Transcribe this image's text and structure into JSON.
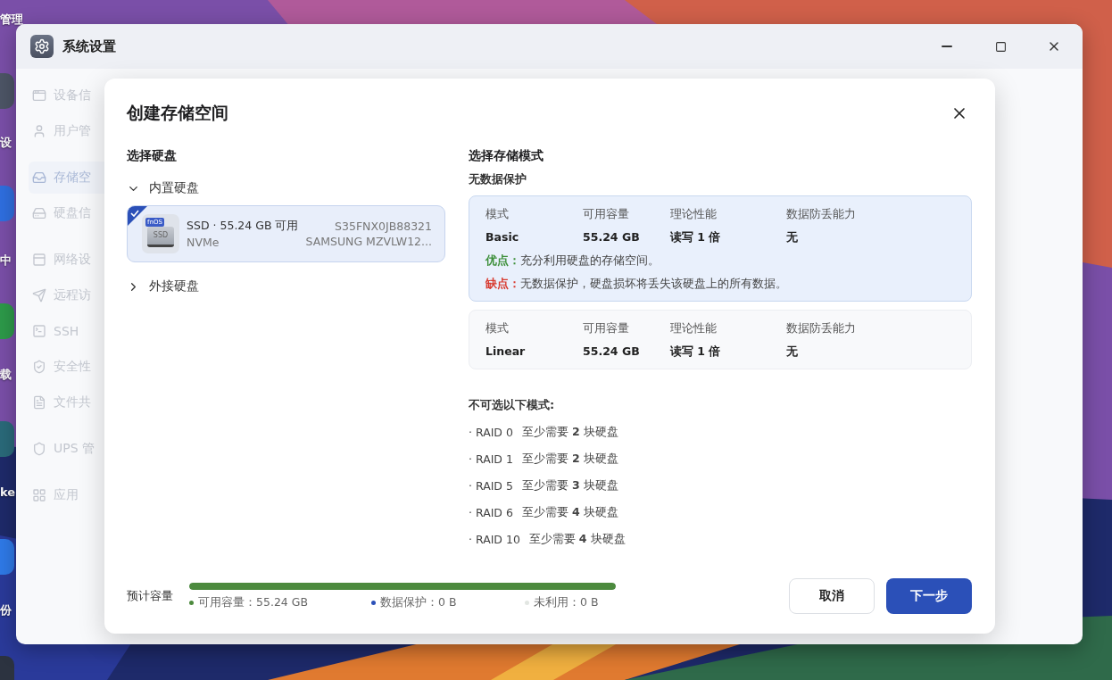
{
  "desktop": {
    "labels": [
      {
        "text": "管理"
      },
      {
        "text": "设"
      },
      {
        "text": "中"
      },
      {
        "text": "载"
      },
      {
        "text": "ke"
      },
      {
        "text": "份"
      }
    ]
  },
  "window": {
    "title": "系统设置",
    "sidebar": {
      "groups": [
        {
          "items": [
            {
              "label": "设备信",
              "selected": false
            },
            {
              "label": "用户管",
              "selected": false
            }
          ]
        },
        {
          "items": [
            {
              "label": "存储空",
              "selected": true
            },
            {
              "label": "硬盘信",
              "selected": false
            }
          ]
        },
        {
          "items": [
            {
              "label": "网络设",
              "selected": false
            },
            {
              "label": "远程访",
              "selected": false
            },
            {
              "label": "SSH",
              "selected": false
            },
            {
              "label": "安全性",
              "selected": false
            },
            {
              "label": "文件共",
              "selected": false
            }
          ]
        },
        {
          "items": [
            {
              "label": "UPS 管",
              "selected": false
            }
          ]
        },
        {
          "items": [
            {
              "label": "应用",
              "selected": false
            }
          ]
        }
      ]
    }
  },
  "dialog": {
    "title": "创建存储空间",
    "disk_section": {
      "title": "选择硬盘",
      "groups": [
        {
          "label": "内置硬盘",
          "expanded": true,
          "disks": [
            {
              "icon_badge": "fnOS",
              "icon_text": "SSD",
              "name": "SSD · 55.24 GB 可用",
              "interface": "NVMe",
              "serial": "S35FNX0JB88321",
              "model": "SAMSUNG MZVLW12...",
              "selected": true
            }
          ]
        },
        {
          "label": "外接硬盘",
          "expanded": false
        }
      ]
    },
    "mode_section": {
      "title": "选择存储模式",
      "subtitle": "无数据保护",
      "modes": [
        {
          "headers": [
            "模式",
            "可用容量",
            "理论性能",
            "数据防丢能力"
          ],
          "values": [
            "Basic",
            "55.24 GB",
            "读写 1 倍",
            "无"
          ],
          "selected": true,
          "pros_label": "优点：",
          "pros": "充分利用硬盘的存储空间。",
          "cons_label": "缺点：",
          "cons": "无数据保护，硬盘损坏将丢失该硬盘上的所有数据。"
        },
        {
          "headers": [
            "模式",
            "可用容量",
            "理论性能",
            "数据防丢能力"
          ],
          "values": [
            "Linear",
            "55.24 GB",
            "读写 1 倍",
            "无"
          ],
          "selected": false
        }
      ],
      "unavailable_title": "不可选以下模式:",
      "unavailable": [
        {
          "mode": "· RAID 0",
          "requirement": "至少需要 **2** 块硬盘"
        },
        {
          "mode": "· RAID 1",
          "requirement": "至少需要 **2** 块硬盘"
        },
        {
          "mode": "· RAID 5",
          "requirement": "至少需要 **3** 块硬盘"
        },
        {
          "mode": "· RAID 6",
          "requirement": "至少需要 **4** 块硬盘"
        },
        {
          "mode": "· RAID 10",
          "requirement": "至少需要 **4** 块硬盘"
        }
      ]
    },
    "footer": {
      "label": "预计容量",
      "level": 1,
      "legend": [
        {
          "text": "可用容量：55.24 GB",
          "color": "#4c8a3e"
        },
        {
          "text": "数据保护：0 B",
          "color": "#2b50b8"
        },
        {
          "text": "未利用：0 B",
          "color": "#e2e6e2"
        }
      ],
      "buttons": [
        {
          "label": "取消",
          "kind": "secondary"
        },
        {
          "label": "下一步",
          "kind": "primary"
        }
      ]
    }
  }
}
